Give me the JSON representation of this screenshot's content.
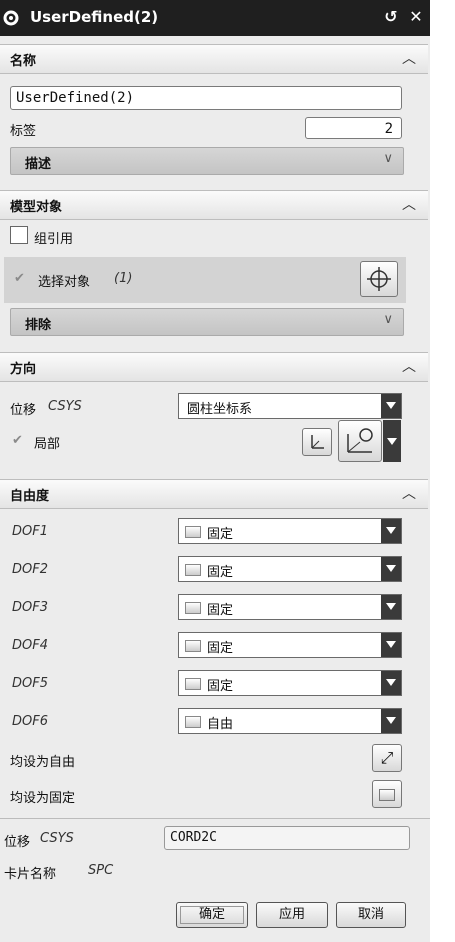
{
  "window": {
    "title": "UserDefined(2)"
  },
  "sections": {
    "name": {
      "header": "名称",
      "value": "UserDefined(2)",
      "tag_label": "标签",
      "tag_value": "2",
      "description_label": "描述"
    },
    "model_object": {
      "header": "模型对象",
      "group_ref_label": "组引用",
      "select_label": "选择对象",
      "select_count": "(1)",
      "exclude_label": "排除"
    },
    "direction": {
      "header": "方向",
      "csys_label": "位移",
      "csys_sub": "CSYS",
      "csys_value": "圆柱坐标系",
      "local_label": "局部"
    },
    "dof": {
      "header": "自由度",
      "rows": [
        {
          "label": "DOF1",
          "value": "固定"
        },
        {
          "label": "DOF2",
          "value": "固定"
        },
        {
          "label": "DOF3",
          "value": "固定"
        },
        {
          "label": "DOF4",
          "value": "固定"
        },
        {
          "label": "DOF5",
          "value": "固定"
        },
        {
          "label": "DOF6",
          "value": "自由"
        }
      ],
      "all_free_label": "均设为自由",
      "all_fixed_label": "均设为固定"
    }
  },
  "footer": {
    "csys_label": "位移",
    "csys_sub": "CSYS",
    "csys_value": "CORD2C",
    "card_label": "卡片名称",
    "card_value": "SPC"
  },
  "buttons": {
    "ok": "确定",
    "apply": "应用",
    "cancel": "取消"
  }
}
